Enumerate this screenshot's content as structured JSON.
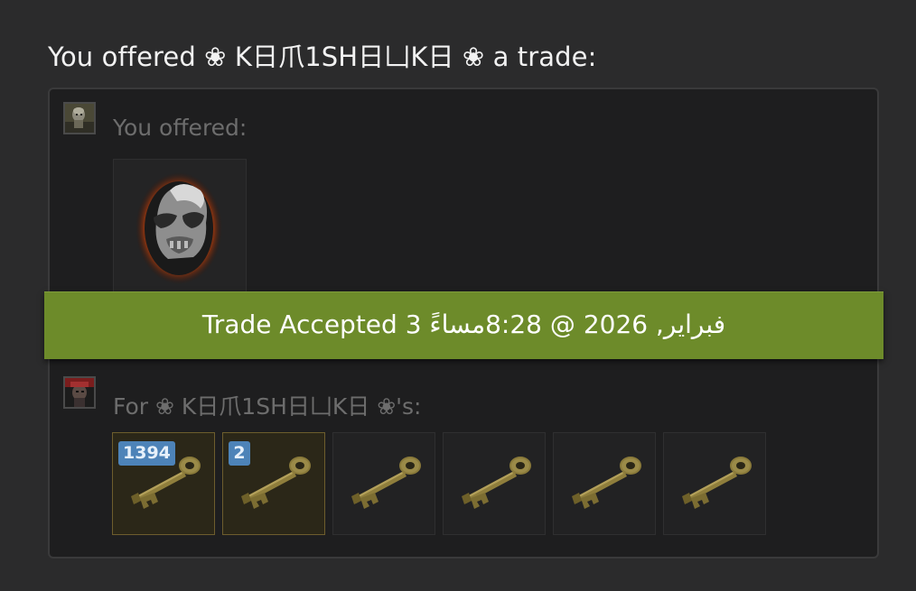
{
  "heading": "You offered ❀ K日爪1SH日凵K日 ❀ a trade:",
  "you_section": {
    "label": "You offered:"
  },
  "banner": {
    "text": "Trade Accepted 3 فبراير, 2026 @ 8:28مساءً"
  },
  "them_section": {
    "label": "For ❀ K日爪1SH日凵K日 ❀'s:",
    "items": [
      {
        "name": "Mann Co. Supply Crate Key",
        "count": "1394",
        "highlighted": true
      },
      {
        "name": "Mann Co. Supply Crate Key",
        "count": "2",
        "highlighted": true
      },
      {
        "name": "Mann Co. Supply Crate Key",
        "count": "",
        "highlighted": false
      },
      {
        "name": "Mann Co. Supply Crate Key",
        "count": "",
        "highlighted": false
      },
      {
        "name": "Mann Co. Supply Crate Key",
        "count": "",
        "highlighted": false
      },
      {
        "name": "Mann Co. Supply Crate Key",
        "count": "",
        "highlighted": false
      }
    ]
  },
  "colors": {
    "banner": "#6d8b2a",
    "badge": "#4d83b8",
    "highlight_border": "#6d5d2d"
  },
  "icons": {
    "given_item": "burning-skull-mask-icon",
    "received_item": "key-icon"
  }
}
